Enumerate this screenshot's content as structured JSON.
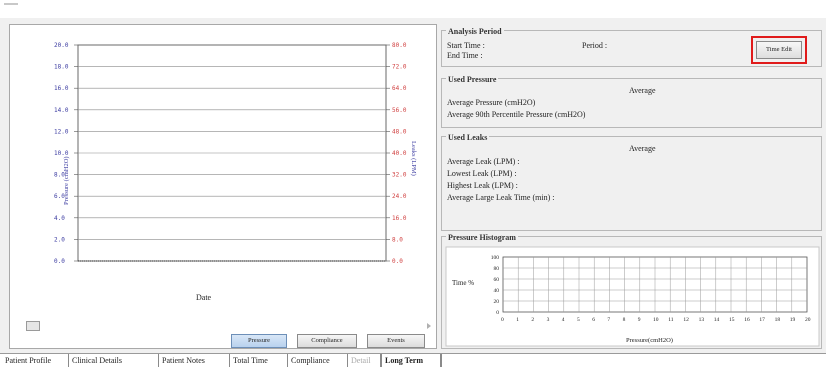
{
  "chart": {
    "left_axis_title": "Pressure (cmH2O)",
    "right_axis_title": "Leaks (LPM)",
    "x_axis_title": "Date",
    "left_ticks": [
      "20.0",
      "18.0",
      "16.0",
      "14.0",
      "12.0",
      "10.0",
      "8.0",
      "6.0",
      "4.0",
      "2.0",
      "0.0"
    ],
    "right_ticks": [
      "80.0",
      "72.0",
      "64.0",
      "56.0",
      "48.0",
      "40.0",
      "32.0",
      "24.0",
      "16.0",
      "8.0",
      "0.0"
    ],
    "colors": {
      "left_axis": "#3a3aa0",
      "right_axis": "#d04040"
    }
  },
  "view_buttons": [
    "Pressure",
    "Compliance",
    "Events"
  ],
  "active_view": "Pressure",
  "analysis_period": {
    "title": "Analysis Period",
    "start_label": "Start Time :",
    "end_label": "End Time :",
    "period_label": "Period :",
    "time_edit_label": "Time Edit",
    "highlight_color": "#e01b1b"
  },
  "used_pressure": {
    "title": "Used Pressure",
    "average_header": "Average",
    "rows": [
      "Average Pressure (cmH2O)",
      "Average 90th Percentile Pressure  (cmH2O)"
    ]
  },
  "used_leaks": {
    "title": "Used Leaks",
    "average_header": "Average",
    "rows": [
      "Average Leak (LPM) :",
      "Lowest Leak (LPM) :",
      "Highest Leak (LPM) :",
      "Average Large Leak Time (min) :"
    ]
  },
  "histogram": {
    "title": "Pressure Histogram",
    "y_title": "Time %",
    "x_title": "Pressure(cmH2O)",
    "y_ticks": [
      "100",
      "80",
      "60",
      "40",
      "20",
      "0"
    ],
    "x_ticks": [
      "0",
      "1",
      "2",
      "3",
      "4",
      "5",
      "6",
      "7",
      "8",
      "9",
      "10",
      "11",
      "12",
      "13",
      "14",
      "15",
      "16",
      "17",
      "18",
      "19",
      "20"
    ]
  },
  "tabs": [
    {
      "label": "Patient Profile",
      "state": "normal"
    },
    {
      "label": "Clinical Details",
      "state": "normal"
    },
    {
      "label": "Patient Notes",
      "state": "normal"
    },
    {
      "label": "Total Time",
      "state": "normal"
    },
    {
      "label": "Compliance",
      "state": "normal"
    },
    {
      "label": "Detail",
      "state": "disabled"
    },
    {
      "label": "Long Term",
      "state": "selected"
    }
  ]
}
